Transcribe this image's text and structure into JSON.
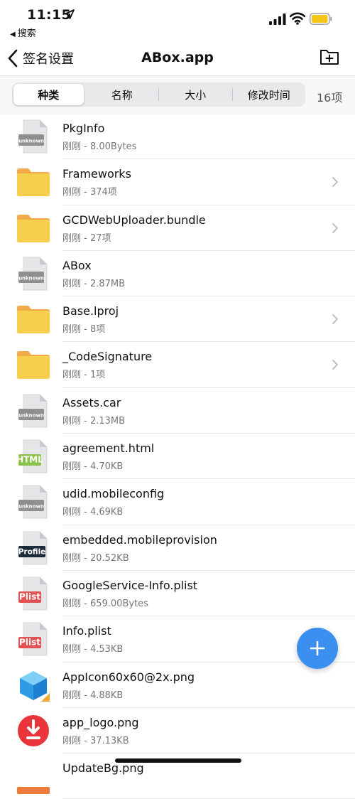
{
  "status_bar": {
    "time": "11:15",
    "back_app": "搜索"
  },
  "nav": {
    "back_label": "签名设置",
    "title": "ABox.app"
  },
  "segments": [
    "种类",
    "名称",
    "大小",
    "修改时间"
  ],
  "item_count": "16项",
  "files": [
    {
      "name": "PkgInfo",
      "meta": "刚刚 - 8.00Bytes",
      "type": "unknown",
      "badge": "unknown"
    },
    {
      "name": "Frameworks",
      "meta": "刚刚 - 374项",
      "type": "folder"
    },
    {
      "name": "GCDWebUploader.bundle",
      "meta": "刚刚 - 27项",
      "type": "folder"
    },
    {
      "name": "ABox",
      "meta": "刚刚 - 2.87MB",
      "type": "unknown",
      "badge": "unknown"
    },
    {
      "name": "Base.lproj",
      "meta": "刚刚 - 8项",
      "type": "folder"
    },
    {
      "name": "_CodeSignature",
      "meta": "刚刚 - 1项",
      "type": "folder"
    },
    {
      "name": "Assets.car",
      "meta": "刚刚 - 2.13MB",
      "type": "unknown",
      "badge": "unknown"
    },
    {
      "name": "agreement.html",
      "meta": "刚刚 - 4.70KB",
      "type": "html",
      "badge": "HTML"
    },
    {
      "name": "udid.mobileconfig",
      "meta": "刚刚 - 4.69KB",
      "type": "unknown",
      "badge": "unknown"
    },
    {
      "name": "embedded.mobileprovision",
      "meta": "刚刚 - 20.52KB",
      "type": "profile",
      "badge": "Profile"
    },
    {
      "name": "GoogleService-Info.plist",
      "meta": "刚刚 - 659.00Bytes",
      "type": "plist",
      "badge": "Plist"
    },
    {
      "name": "Info.plist",
      "meta": "刚刚 - 4.53KB",
      "type": "plist",
      "badge": "Plist"
    },
    {
      "name": "AppIcon60x60@2x.png",
      "meta": "刚刚 - 4.88KB",
      "type": "image-cube"
    },
    {
      "name": "app_logo.png",
      "meta": "刚刚 - 37.13KB",
      "type": "image-logo"
    },
    {
      "name": "UpdateBg.png",
      "meta": "",
      "type": "image-bg"
    }
  ],
  "colors": {
    "folder": "#f6d04d",
    "folder_tab": "#f2a94a",
    "unknown_badge": "#8f8f8f",
    "html_badge": "#8bc34a",
    "profile_badge": "#1d2a3a",
    "plist_badge": "#e05252",
    "accent": "#3b8ff0"
  },
  "icons": {
    "back": "chevron-left-icon",
    "new_folder": "folder-plus-icon",
    "fab": "plus-icon",
    "row_chevron": "chevron-right-icon"
  }
}
